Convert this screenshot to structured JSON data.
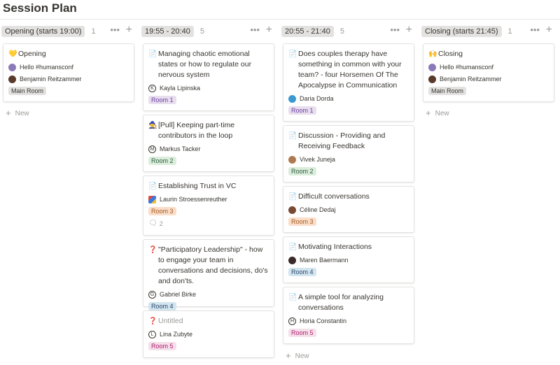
{
  "page": {
    "title": "Session Plan"
  },
  "new_label": "New",
  "columns": [
    {
      "label": "Opening (starts 19:00)",
      "count": "1",
      "cards": [
        {
          "icon": "💛",
          "title": "Opening",
          "props": [
            {
              "avatar": "photo",
              "text": "Hello #humansconf"
            },
            {
              "avatar": "photo",
              "text": "Benjamin Reitzammer"
            }
          ],
          "tag": "Main Room",
          "tag_color": "gray"
        }
      ]
    },
    {
      "label": "19:55 - 20:40",
      "count": "5",
      "cards": [
        {
          "icon": "📄",
          "title": "Managing chaotic emotional states or how to regulate our nervous system",
          "props": [
            {
              "avatar": "K",
              "text": "Kayla Lipinska"
            }
          ],
          "tag": "Room 1",
          "tag_color": "purple"
        },
        {
          "icon": "🧙",
          "title": "[Pull] Keeping part-time contributors in the loop",
          "props": [
            {
              "avatar": "M",
              "text": "Markus Tacker"
            }
          ],
          "tag": "Room 2",
          "tag_color": "green"
        },
        {
          "icon": "📄",
          "title": "Establishing Trust in VC",
          "props": [
            {
              "avatar": "cube",
              "text": "Laurin Stroessenreuther"
            }
          ],
          "tag": "Room 3",
          "tag_color": "orange",
          "comments": "2"
        },
        {
          "icon": "❓",
          "title": "\"Participatory Leadership\" - how to engage your team in conversations and decisions, do's and don'ts.",
          "props": [
            {
              "avatar": "G",
              "text": "Gabriel Birke"
            }
          ],
          "tag": "Room 4",
          "tag_color": "blue"
        },
        {
          "icon": "❓",
          "title": "Untitled",
          "untitled": true,
          "props": [
            {
              "avatar": "L",
              "text": "Lina Zubyte"
            }
          ],
          "tag": "Room 5",
          "tag_color": "pink"
        }
      ]
    },
    {
      "label": "20:55 - 21:40",
      "count": "5",
      "cards": [
        {
          "icon": "📄",
          "title": "Does couples therapy have something in common with your team? - four Horsemen Of The Apocalypse in Communication",
          "props": [
            {
              "avatar": "photo",
              "text": "Daria Dorda"
            }
          ],
          "tag": "Room 1",
          "tag_color": "purple"
        },
        {
          "icon": "📄",
          "title": "Discussion - Providing and Receiving Feedback",
          "props": [
            {
              "avatar": "photo",
              "text": "Vivek Juneja"
            }
          ],
          "tag": "Room 2",
          "tag_color": "green"
        },
        {
          "icon": "📄",
          "title": "Difficult conversations",
          "props": [
            {
              "avatar": "photo",
              "text": "Céline Dedaj"
            }
          ],
          "tag": "Room 3",
          "tag_color": "orange"
        },
        {
          "icon": "📄",
          "title": "Motivating Interactions",
          "props": [
            {
              "avatar": "photo",
              "text": "Maren Baermann"
            }
          ],
          "tag": "Room 4",
          "tag_color": "blue"
        },
        {
          "icon": "📄",
          "title": "A simple tool for analyzing conversations",
          "props": [
            {
              "avatar": "H",
              "text": "Horia Constantin"
            }
          ],
          "tag": "Room 5",
          "tag_color": "pink"
        }
      ]
    },
    {
      "label": "Closing (starts 21:45)",
      "count": "1",
      "cards": [
        {
          "icon": "🙌",
          "title": "Closing",
          "props": [
            {
              "avatar": "photo",
              "text": "Hello #humansconf"
            },
            {
              "avatar": "photo",
              "text": "Benjamin Reitzammer"
            }
          ],
          "tag": "Main Room",
          "tag_color": "gray"
        }
      ]
    }
  ]
}
